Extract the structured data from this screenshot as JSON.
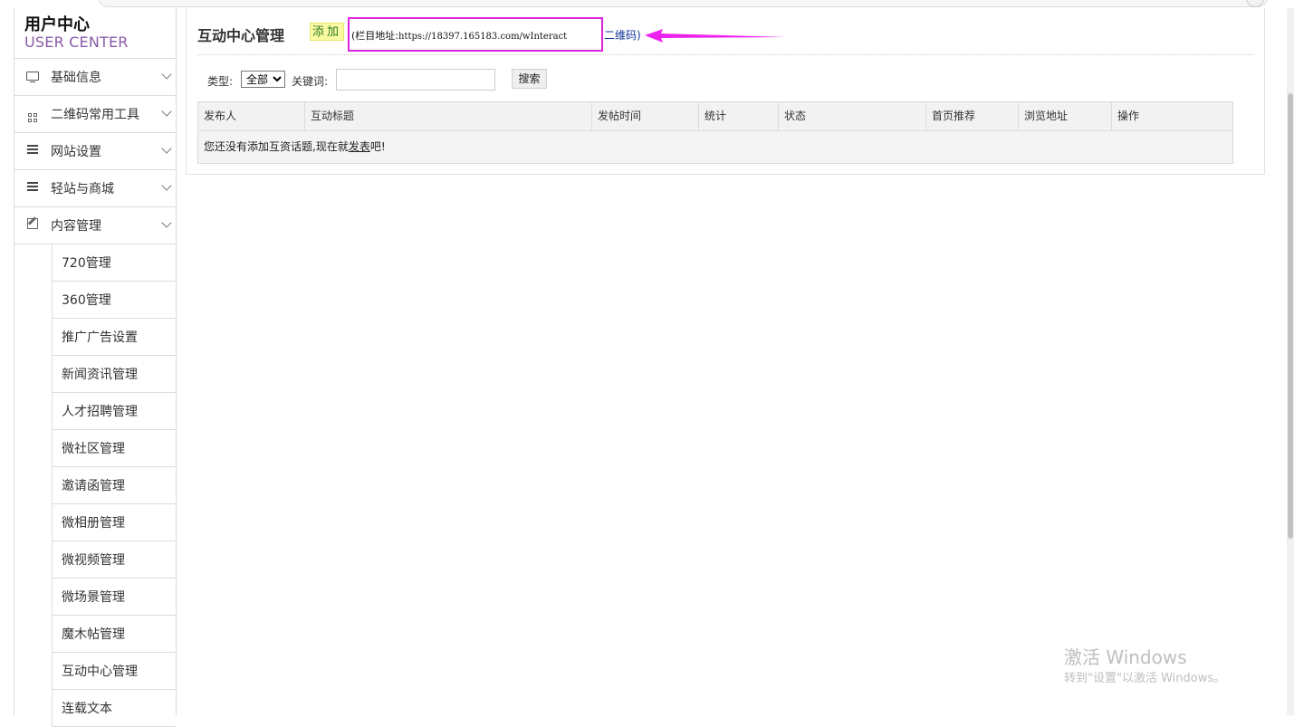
{
  "brand": {
    "title_cn": "用户中心",
    "title_en": "USER CENTER"
  },
  "sidebar": {
    "menus": [
      {
        "label": "基础信息",
        "icon": "monitor-icon"
      },
      {
        "label": "二维码常用工具",
        "icon": "qrcode-icon"
      },
      {
        "label": "网站设置",
        "icon": "menu-icon"
      },
      {
        "label": "轻站与商城",
        "icon": "menu-icon"
      },
      {
        "label": "内容管理",
        "icon": "edit-icon"
      }
    ],
    "sub_items": [
      "720管理",
      "360管理",
      "推广广告设置",
      "新闻资讯管理",
      "人才招聘管理",
      "微社区管理",
      "邀请函管理",
      "微相册管理",
      "微视频管理",
      "微场景管理",
      "魔木帖管理",
      "互动中心管理",
      "连载文本"
    ]
  },
  "header": {
    "title": "互动中心管理",
    "add_button": "添加",
    "address_prefix": "(栏目地址:",
    "address_url": "https://18397.165183.com/wInteract",
    "qr_link": "二维码",
    "qr_suffix": ")",
    "highlight_color": "#dd22dd"
  },
  "filters": {
    "type_label": "类型:",
    "type_value": "全部",
    "keyword_label": "关键词:",
    "keyword_value": "",
    "search_button": "搜索"
  },
  "table": {
    "columns": [
      "发布人",
      "互动标题",
      "发帖时间",
      "统计",
      "状态",
      "首页推荐",
      "浏览地址",
      "操作"
    ],
    "empty_message_prefix": "您还没有添加互资话题,现在就",
    "empty_message_link": "发表",
    "empty_message_suffix": "吧!"
  },
  "watermark": {
    "line1": "激活 Windows",
    "line2": "转到\"设置\"以激活 Windows。"
  }
}
